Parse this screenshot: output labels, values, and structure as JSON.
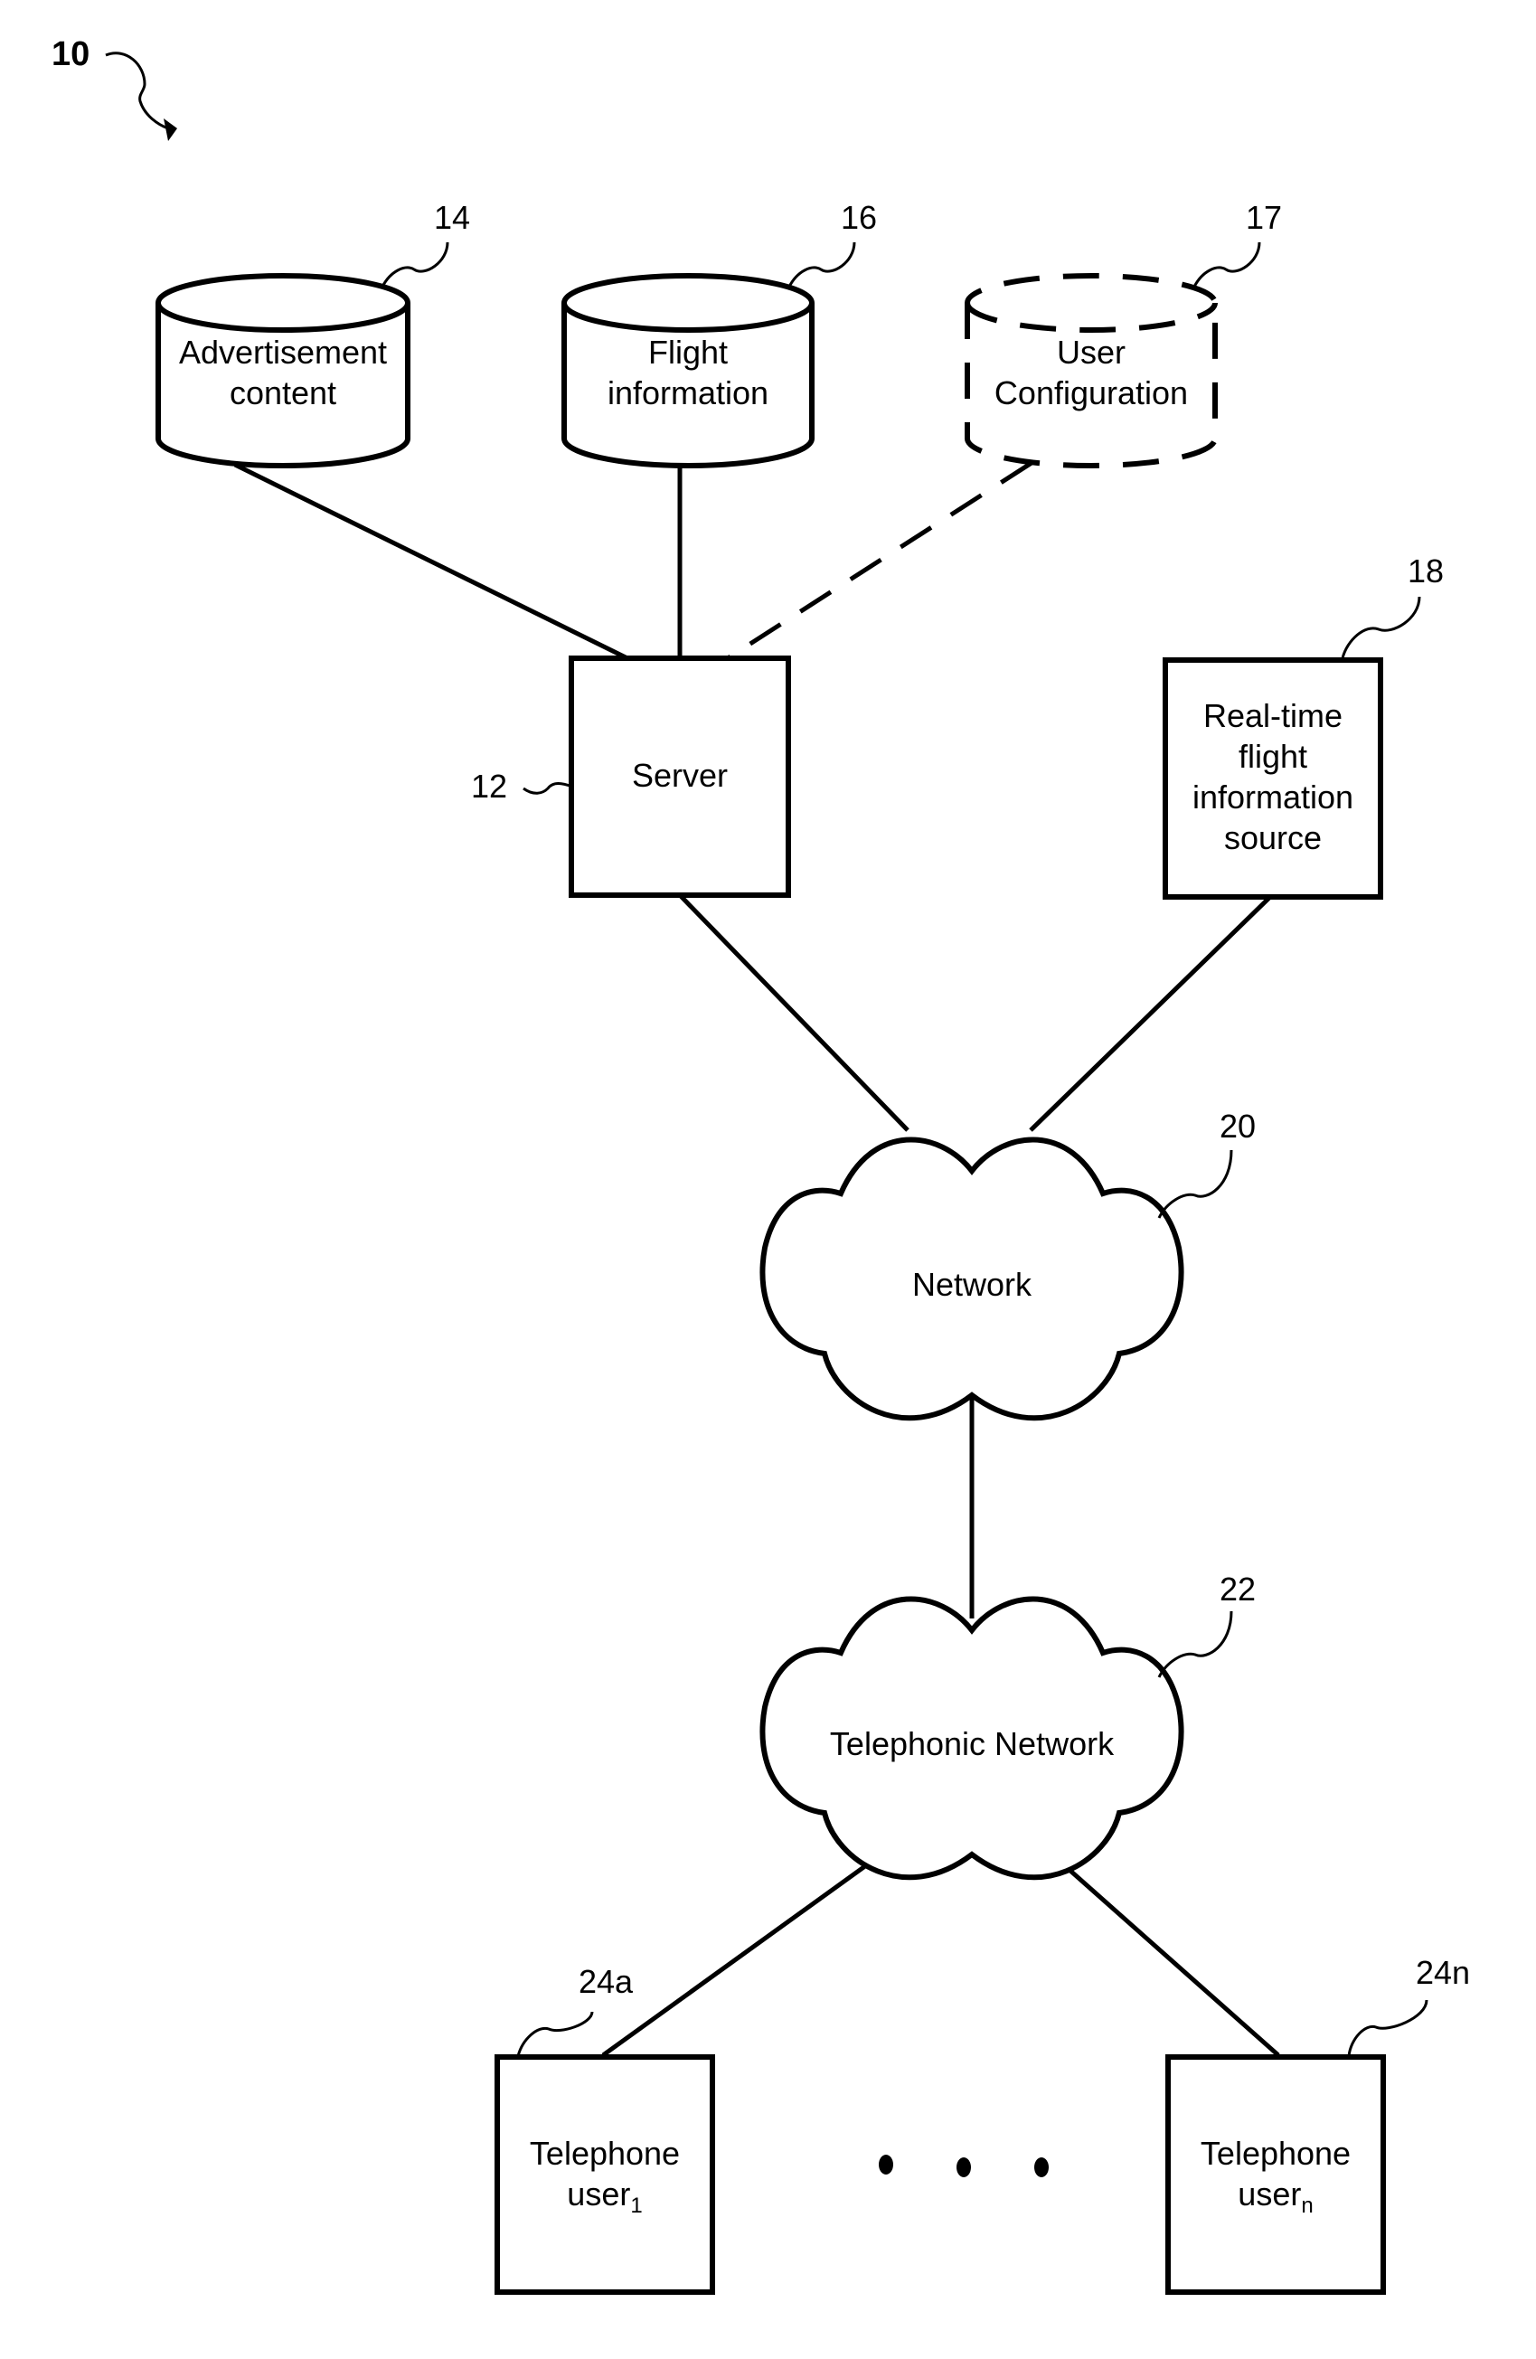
{
  "figure": {
    "ref": "10",
    "nodes": {
      "advertisement_content": {
        "ref": "14",
        "kind": "database",
        "lines": [
          "Advertisement",
          "content"
        ]
      },
      "flight_information": {
        "ref": "16",
        "kind": "database",
        "lines": [
          "Flight",
          "information"
        ]
      },
      "user_configuration": {
        "ref": "17",
        "kind": "database-optional",
        "lines": [
          "User",
          "Configuration"
        ]
      },
      "server": {
        "ref": "12",
        "kind": "box",
        "lines": [
          "Server"
        ]
      },
      "realtime_source": {
        "ref": "18",
        "kind": "box",
        "lines": [
          "Real-time",
          "flight",
          "information",
          "source"
        ]
      },
      "network": {
        "ref": "20",
        "kind": "cloud",
        "lines": [
          "Network"
        ]
      },
      "telephonic_network": {
        "ref": "22",
        "kind": "cloud",
        "lines": [
          "Telephonic Network"
        ]
      },
      "telephone_user_1": {
        "ref": "24a",
        "kind": "box",
        "line1": "Telephone",
        "line2_base": "user",
        "line2_sub": "1"
      },
      "telephone_user_n": {
        "ref": "24n",
        "kind": "box",
        "line1": "Telephone",
        "line2_base": "user",
        "line2_sub": "n"
      }
    },
    "ellipsis_dots": 3,
    "edges": [
      {
        "from": "advertisement_content",
        "to": "server",
        "style": "solid"
      },
      {
        "from": "flight_information",
        "to": "server",
        "style": "solid"
      },
      {
        "from": "user_configuration",
        "to": "server",
        "style": "dashed"
      },
      {
        "from": "server",
        "to": "network",
        "style": "solid"
      },
      {
        "from": "realtime_source",
        "to": "network",
        "style": "solid"
      },
      {
        "from": "network",
        "to": "telephonic_network",
        "style": "solid"
      },
      {
        "from": "telephonic_network",
        "to": "telephone_user_1",
        "style": "solid"
      },
      {
        "from": "telephonic_network",
        "to": "telephone_user_n",
        "style": "solid"
      }
    ]
  }
}
